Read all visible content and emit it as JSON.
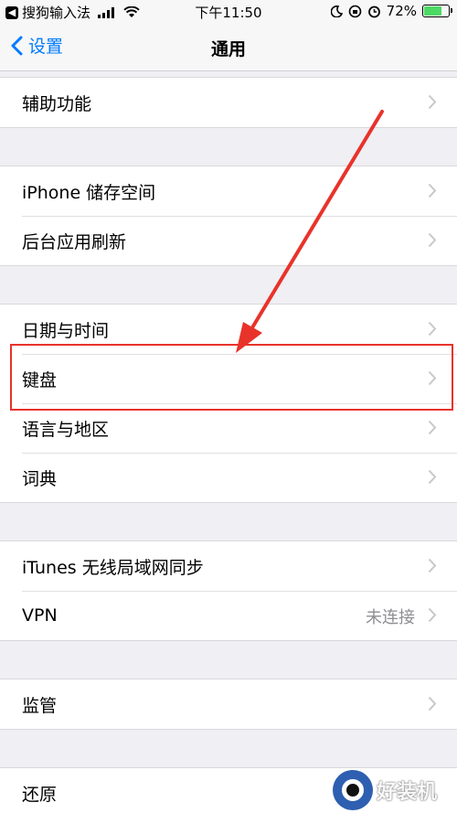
{
  "status_bar": {
    "back_app": "搜狗输入法",
    "time": "下午11:50",
    "battery_percent": "72%",
    "battery_level": 0.72
  },
  "nav": {
    "back_label": "设置",
    "title": "通用"
  },
  "groups": [
    {
      "rows": [
        {
          "label": "辅助功能"
        }
      ]
    },
    {
      "rows": [
        {
          "label": "iPhone 储存空间"
        },
        {
          "label": "后台应用刷新"
        }
      ]
    },
    {
      "rows": [
        {
          "label": "日期与时间"
        },
        {
          "label": "键盘"
        },
        {
          "label": "语言与地区"
        },
        {
          "label": "词典"
        }
      ]
    },
    {
      "rows": [
        {
          "label": "iTunes 无线局域网同步"
        },
        {
          "label": "VPN",
          "detail": "未连接"
        }
      ]
    },
    {
      "rows": [
        {
          "label": "监管"
        }
      ]
    },
    {
      "rows": [
        {
          "label": "还原"
        }
      ]
    }
  ],
  "watermark": {
    "text": "好装机"
  },
  "colors": {
    "accent": "#007aff",
    "annotation": "#e8332b",
    "background": "#efeff4"
  }
}
